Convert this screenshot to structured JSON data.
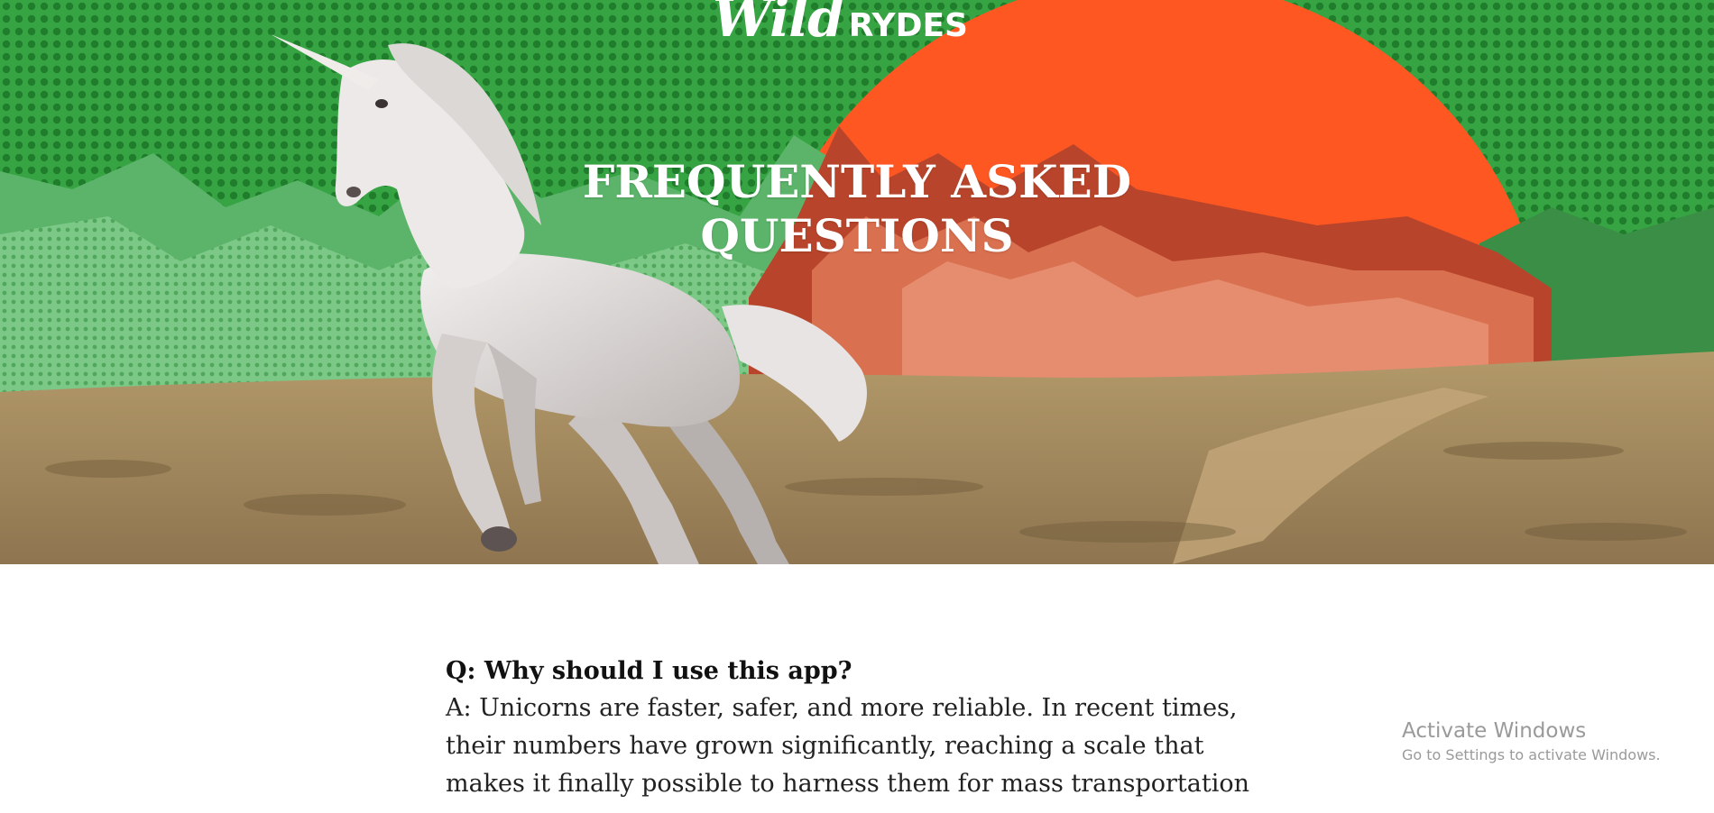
{
  "brand": {
    "logo_part1": "Wild",
    "logo_part2": "RYDES",
    "colors": {
      "green": "#2f9a3c",
      "orange_sun": "#ff5722",
      "white": "#ffffff"
    }
  },
  "hero": {
    "title": "FREQUENTLY ASKED QUESTIONS",
    "image": "unicorn-in-prairie-with-sun-and-mountains"
  },
  "faq": {
    "items": [
      {
        "question": "Q: Why should I use this app?",
        "answer": "A: Unicorns are faster, safer, and more reliable. In recent times, their numbers have grown significantly, reaching a scale that makes it finally possible to harness them for mass transportation"
      }
    ]
  },
  "os_watermark": {
    "line1": "Activate Windows",
    "line2": "Go to Settings to activate Windows."
  }
}
